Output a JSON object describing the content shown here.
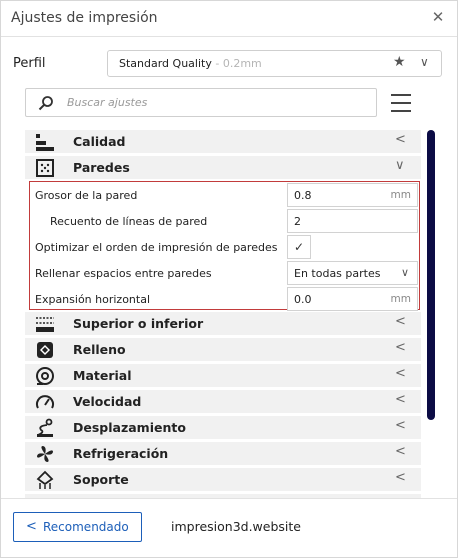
{
  "window": {
    "title": "Ajustes de impresión"
  },
  "profile": {
    "label": "Perfil",
    "name": "Standard Quality",
    "sub": " - 0.2mm"
  },
  "search": {
    "placeholder": "Buscar ajustes"
  },
  "categories": [
    {
      "label": "Calidad",
      "icon": "quality-icon"
    },
    {
      "label": "Paredes",
      "icon": "walls-icon",
      "expanded": true
    },
    {
      "label": "Superior o inferior",
      "icon": "top-bottom-icon"
    },
    {
      "label": "Relleno",
      "icon": "infill-icon"
    },
    {
      "label": "Material",
      "icon": "material-icon"
    },
    {
      "label": "Velocidad",
      "icon": "speed-icon"
    },
    {
      "label": "Desplazamiento",
      "icon": "travel-icon"
    },
    {
      "label": "Refrigeración",
      "icon": "cooling-icon"
    },
    {
      "label": "Soporte",
      "icon": "support-icon"
    }
  ],
  "walls": {
    "thickness": {
      "label": "Grosor de la pared",
      "value": "0.8",
      "unit": "mm"
    },
    "line_count": {
      "label": "Recuento de líneas de pared",
      "value": "2"
    },
    "optimize": {
      "label": "Optimizar el orden de impresión de paredes",
      "checked": true,
      "mark": "✓"
    },
    "fill_gaps": {
      "label": "Rellenar espacios entre paredes",
      "value": "En todas partes"
    },
    "expansion": {
      "label": "Expansión horizontal",
      "value": "0.0",
      "unit": "mm"
    }
  },
  "footer": {
    "recommended_label": "Recomendado",
    "watermark": "impresion3d.website"
  },
  "colors": {
    "accent": "#1d5fb9",
    "highlight_border": "#c23b3b",
    "scrollbar": "#0c0c45"
  }
}
